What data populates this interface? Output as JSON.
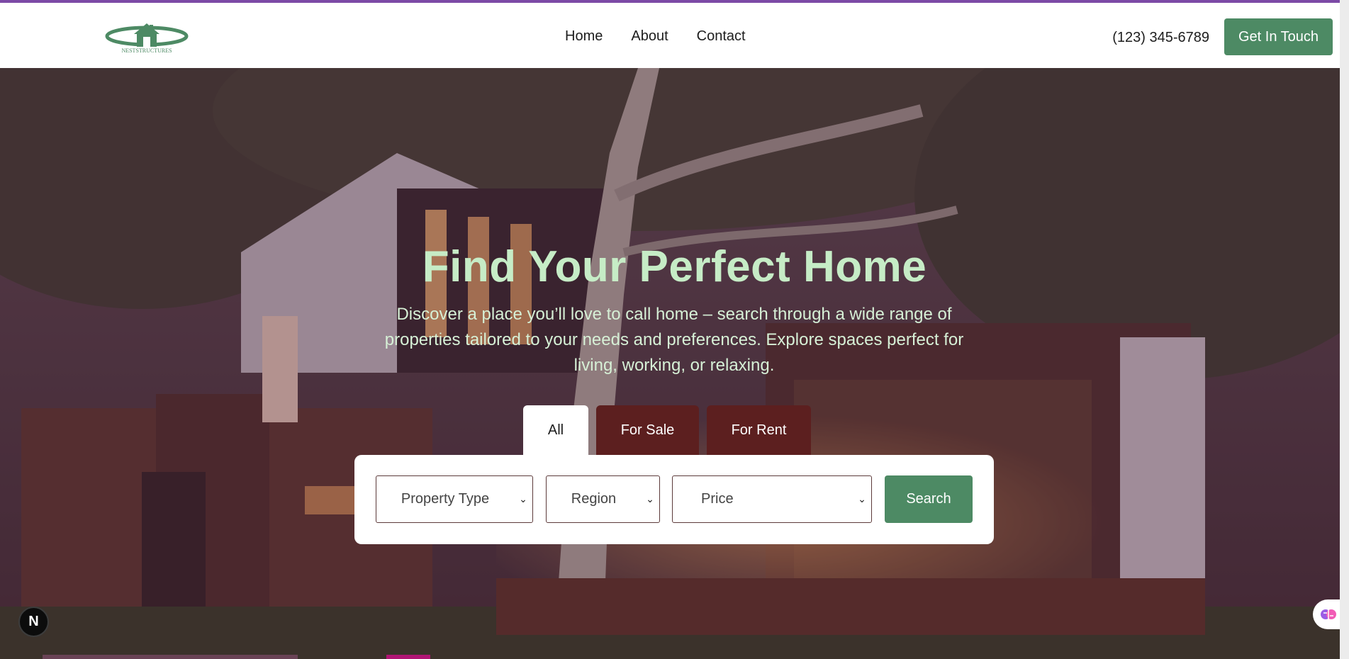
{
  "nav": {
    "logo_text": "NESTSTRUCTURES",
    "links": [
      "Home",
      "About",
      "Contact"
    ],
    "phone": "(123) 345-6789",
    "cta_label": "Get In Touch"
  },
  "hero": {
    "title": "Find Your Perfect Home",
    "subtitle": "Discover a place you’ll love to call home – search through a wide range of properties tailored to your needs and preferences. Explore spaces perfect for living, working, or relaxing."
  },
  "search": {
    "tabs": [
      "All",
      "For Sale",
      "For Rent"
    ],
    "active_tab": "All",
    "property_type": "Property Type",
    "region": "Region",
    "price": "Price",
    "button_label": "Search"
  },
  "badges": {
    "dev_badge": "N"
  },
  "colors": {
    "brand_green": "#4d8a64",
    "tab_maroon": "#5c1f1f",
    "hero_title": "#c6ecc6",
    "top_accent": "#7c4aa6"
  }
}
